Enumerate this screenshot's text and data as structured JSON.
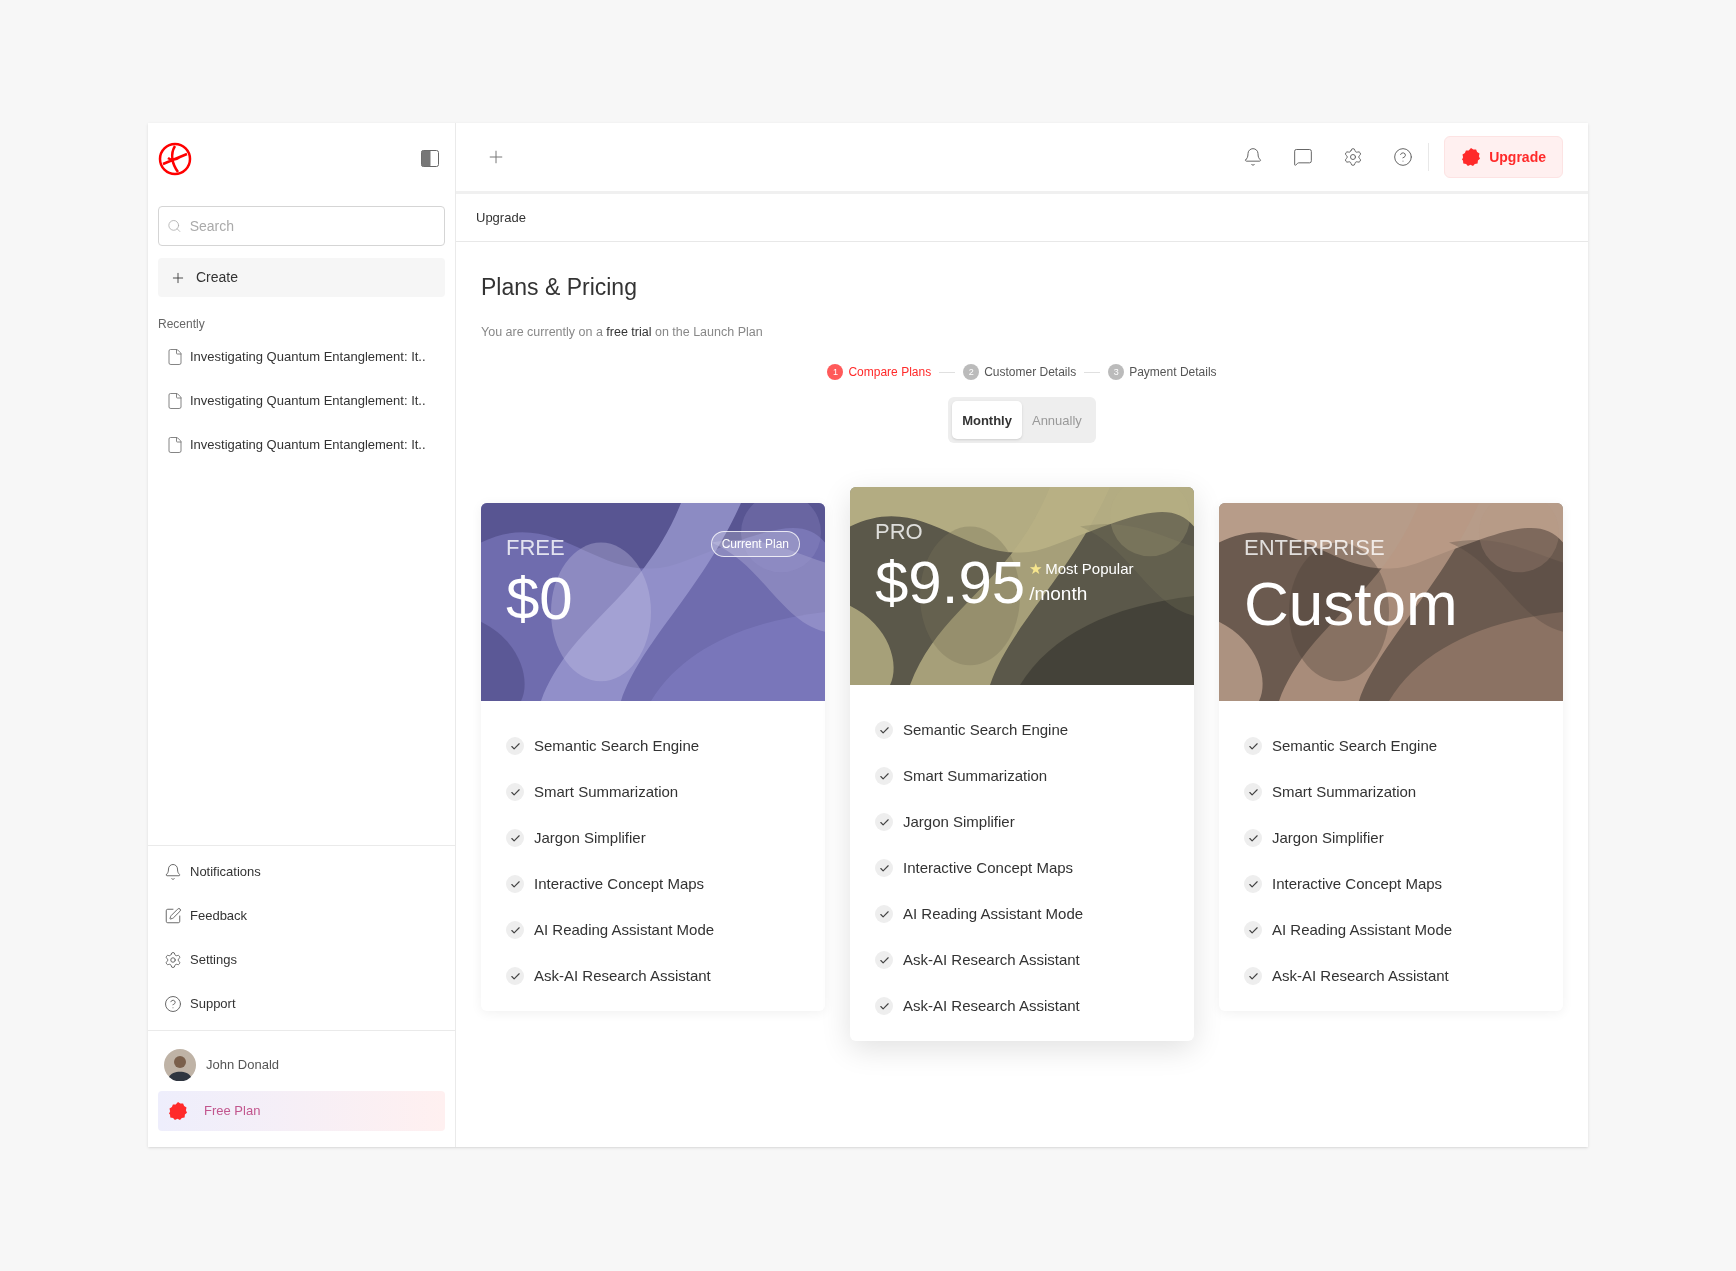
{
  "topbar": {
    "upgrade_button": "Upgrade"
  },
  "sidebar": {
    "search": {
      "placeholder": "Search"
    },
    "create": "Create",
    "recent_heading": "Recently",
    "recent": [
      "Investigating Quantum Entanglement: It..",
      "Investigating Quantum Entanglement: It..",
      "Investigating Quantum Entanglement: It.."
    ],
    "nav": [
      {
        "kind": "bell",
        "label": "Notifications"
      },
      {
        "kind": "feedback",
        "label": "Feedback"
      },
      {
        "kind": "gear",
        "label": "Settings"
      },
      {
        "kind": "help",
        "label": "Support"
      }
    ],
    "user": {
      "name": "John Donald"
    },
    "plan": "Free Plan"
  },
  "breadcrumb": "Upgrade",
  "page": {
    "title": "Plans & Pricing",
    "subtitle": "You are currently on a **free trial** on the Launch Plan"
  },
  "steps": [
    {
      "number": "1",
      "label": "Compare Plans",
      "selected": true
    },
    {
      "number": "2",
      "label": "Customer Details",
      "selected": false
    },
    {
      "number": "3",
      "label": "Payment Details",
      "selected": false
    }
  ],
  "billing": [
    {
      "label": "Monthly",
      "selected": true
    },
    {
      "label": "Annually",
      "selected": false
    }
  ],
  "plans": [
    {
      "name": "FREE",
      "price": "$0",
      "badge": "Current Plan",
      "featured": false,
      "features": [
        "Semantic Search Engine",
        "Smart Summarization",
        "Jargon Simplifier",
        "Interactive Concept Maps",
        "AI Reading Assistant Mode",
        "Ask-AI Research Assistant"
      ]
    },
    {
      "name": "PRO",
      "price": "$9.95",
      "star": "★",
      "tag": "Most Popular",
      "period": "/month",
      "featured": true,
      "features": [
        "Semantic Search Engine",
        "Smart Summarization",
        "Jargon Simplifier",
        "Interactive Concept Maps",
        "AI Reading Assistant Mode",
        "Ask-AI Research Assistant",
        "Ask-AI Research Assistant"
      ]
    },
    {
      "name": "ENTERPRISE",
      "price": "Custom",
      "featured": false,
      "features": [
        "Semantic Search Engine",
        "Smart Summarization",
        "Jargon Simplifier",
        "Interactive Concept Maps",
        "AI Reading Assistant Mode",
        "Ask-AI Research Assistant"
      ]
    }
  ]
}
